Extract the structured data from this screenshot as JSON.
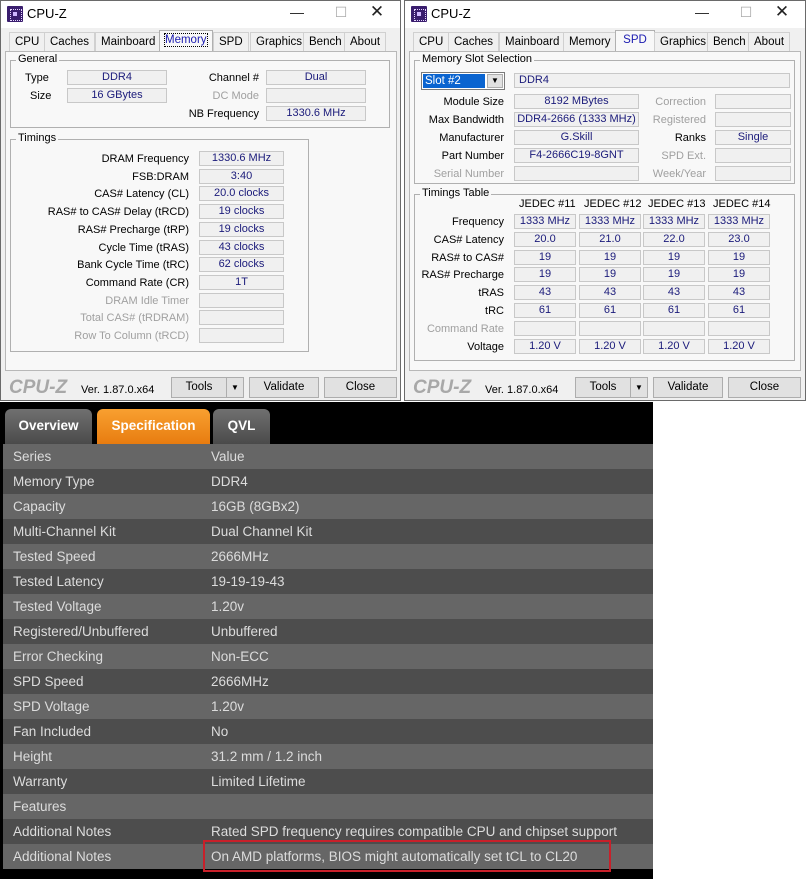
{
  "cpuz_memory": {
    "title": "CPU-Z",
    "controls": {
      "minimize": "—",
      "maximize": "☐",
      "close": "✕"
    },
    "tabs": [
      "CPU",
      "Caches",
      "Mainboard",
      "Memory",
      "SPD",
      "Graphics",
      "Bench",
      "About"
    ],
    "active_tab": "Memory",
    "general": {
      "label": "General",
      "type_label": "Type",
      "type": "DDR4",
      "size_label": "Size",
      "size": "16 GBytes",
      "channel_label": "Channel #",
      "channel": "Dual",
      "dc_mode_label": "DC Mode",
      "dc_mode": "",
      "nb_freq_label": "NB Frequency",
      "nb_freq": "1330.6 MHz"
    },
    "timings": {
      "label": "Timings",
      "rows": [
        {
          "label": "DRAM Frequency",
          "value": "1330.6 MHz",
          "enabled": true
        },
        {
          "label": "FSB:DRAM",
          "value": "3:40",
          "enabled": true
        },
        {
          "label": "CAS# Latency (CL)",
          "value": "20.0 clocks",
          "enabled": true
        },
        {
          "label": "RAS# to CAS# Delay (tRCD)",
          "value": "19 clocks",
          "enabled": true
        },
        {
          "label": "RAS# Precharge (tRP)",
          "value": "19 clocks",
          "enabled": true
        },
        {
          "label": "Cycle Time (tRAS)",
          "value": "43 clocks",
          "enabled": true
        },
        {
          "label": "Bank Cycle Time (tRC)",
          "value": "62 clocks",
          "enabled": true
        },
        {
          "label": "Command Rate (CR)",
          "value": "1T",
          "enabled": true
        },
        {
          "label": "DRAM Idle Timer",
          "value": "",
          "enabled": false
        },
        {
          "label": "Total CAS# (tRDRAM)",
          "value": "",
          "enabled": false
        },
        {
          "label": "Row To Column (tRCD)",
          "value": "",
          "enabled": false
        }
      ]
    },
    "footer": {
      "brand": "CPU-Z",
      "version": "Ver. 1.87.0.x64",
      "tools": "Tools",
      "validate": "Validate",
      "close": "Close",
      "dropdown_arrow": "▼"
    }
  },
  "cpuz_spd": {
    "title": "CPU-Z",
    "controls": {
      "minimize": "—",
      "maximize": "☐",
      "close": "✕"
    },
    "tabs": [
      "CPU",
      "Caches",
      "Mainboard",
      "Memory",
      "SPD",
      "Graphics",
      "Bench",
      "About"
    ],
    "active_tab": "SPD",
    "slot_selection": {
      "label": "Memory Slot Selection",
      "slot": "Slot #2",
      "dropdown_arrow": "▼",
      "type": "DDR4",
      "module_size_label": "Module Size",
      "module_size": "8192 MBytes",
      "max_bw_label": "Max Bandwidth",
      "max_bw": "DDR4-2666 (1333 MHz)",
      "manufacturer_label": "Manufacturer",
      "manufacturer": "G.Skill",
      "part_label": "Part Number",
      "part": "F4-2666C19-8GNT",
      "serial_label": "Serial Number",
      "serial": "",
      "correction_label": "Correction",
      "correction": "",
      "registered_label": "Registered",
      "registered": "",
      "ranks_label": "Ranks",
      "ranks": "Single",
      "spd_ext_label": "SPD Ext.",
      "spd_ext": "",
      "week_year_label": "Week/Year",
      "week_year": ""
    },
    "timings_table": {
      "label": "Timings Table",
      "columns": [
        "JEDEC #11",
        "JEDEC #12",
        "JEDEC #13",
        "JEDEC #14"
      ],
      "rows": [
        {
          "label": "Frequency",
          "enabled": true,
          "values": [
            "1333 MHz",
            "1333 MHz",
            "1333 MHz",
            "1333 MHz"
          ]
        },
        {
          "label": "CAS# Latency",
          "enabled": true,
          "values": [
            "20.0",
            "21.0",
            "22.0",
            "23.0"
          ]
        },
        {
          "label": "RAS# to CAS#",
          "enabled": true,
          "values": [
            "19",
            "19",
            "19",
            "19"
          ]
        },
        {
          "label": "RAS# Precharge",
          "enabled": true,
          "values": [
            "19",
            "19",
            "19",
            "19"
          ]
        },
        {
          "label": "tRAS",
          "enabled": true,
          "values": [
            "43",
            "43",
            "43",
            "43"
          ]
        },
        {
          "label": "tRC",
          "enabled": true,
          "values": [
            "61",
            "61",
            "61",
            "61"
          ]
        },
        {
          "label": "Command Rate",
          "enabled": false,
          "values": [
            "",
            "",
            "",
            ""
          ]
        },
        {
          "label": "Voltage",
          "enabled": true,
          "values": [
            "1.20 V",
            "1.20 V",
            "1.20 V",
            "1.20 V"
          ]
        }
      ]
    },
    "footer": {
      "brand": "CPU-Z",
      "version": "Ver. 1.87.0.x64",
      "tools": "Tools",
      "validate": "Validate",
      "close": "Close",
      "dropdown_arrow": "▼"
    }
  },
  "spec_panel": {
    "tabs": [
      {
        "label": "Overview",
        "active": false
      },
      {
        "label": "Specification",
        "active": true
      },
      {
        "label": "QVL",
        "active": false
      }
    ],
    "colors": {
      "active_tab": "#f08a1c",
      "highlight": "#c8202a"
    },
    "rows": [
      {
        "key": "Series",
        "value": "Value"
      },
      {
        "key": "Memory Type",
        "value": "DDR4"
      },
      {
        "key": "Capacity",
        "value": "16GB (8GBx2)"
      },
      {
        "key": "Multi-Channel Kit",
        "value": "Dual Channel Kit"
      },
      {
        "key": "Tested Speed",
        "value": "2666MHz"
      },
      {
        "key": "Tested Latency",
        "value": "19-19-19-43"
      },
      {
        "key": "Tested Voltage",
        "value": "1.20v"
      },
      {
        "key": "Registered/Unbuffered",
        "value": "Unbuffered"
      },
      {
        "key": "Error Checking",
        "value": "Non-ECC"
      },
      {
        "key": "SPD Speed",
        "value": "2666MHz"
      },
      {
        "key": "SPD Voltage",
        "value": "1.20v"
      },
      {
        "key": "Fan Included",
        "value": "No"
      },
      {
        "key": "Height",
        "value": "31.2 mm / 1.2 inch"
      },
      {
        "key": "Warranty",
        "value": "Limited Lifetime"
      },
      {
        "key": "Features",
        "value": ""
      },
      {
        "key": "Additional Notes",
        "value": "Rated SPD frequency requires compatible CPU and chipset support"
      },
      {
        "key": "Additional Notes",
        "value": "On AMD platforms, BIOS might automatically set tCL to CL20"
      }
    ],
    "highlighted_row": 16
  }
}
